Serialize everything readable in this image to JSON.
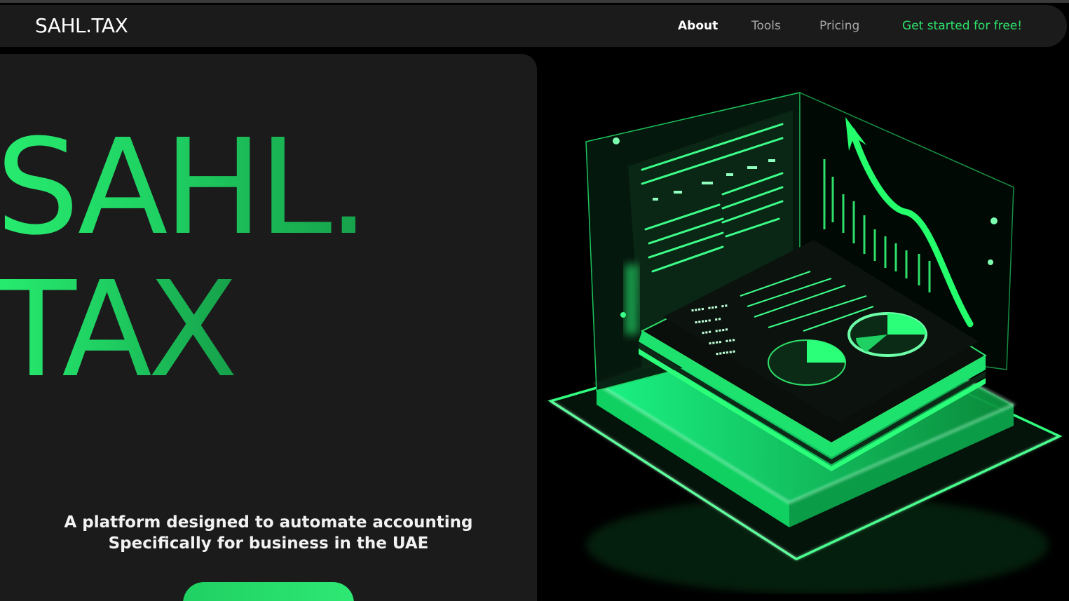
{
  "brand": {
    "logo": "SAHL.TAX",
    "accent_color": "#2ee06a"
  },
  "nav": {
    "links": [
      {
        "label": "About",
        "active": true
      },
      {
        "label": "Tools",
        "active": false
      },
      {
        "label": "Pricing",
        "active": false
      }
    ],
    "cta_label": "Get started for free!"
  },
  "hero": {
    "headline_line1": "SAHL.",
    "headline_line2": "TAX",
    "tagline_line1": "A platform designed to automate accounting",
    "tagline_line2": "Specifically for business in the UAE",
    "cta_button_label": ""
  },
  "illustration": {
    "description_icon": "isometric-accounting-dashboard-illustration"
  }
}
